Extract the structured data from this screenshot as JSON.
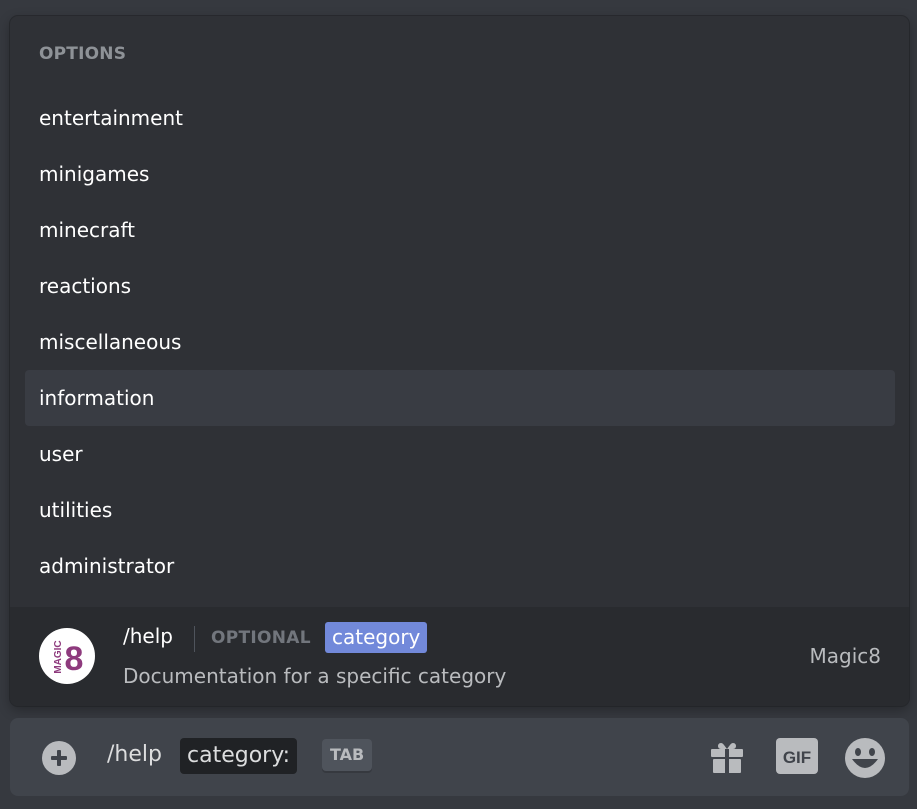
{
  "options": {
    "header": "OPTIONS",
    "items": [
      {
        "label": "entertainment",
        "selected": false
      },
      {
        "label": "minigames",
        "selected": false
      },
      {
        "label": "minecraft",
        "selected": false
      },
      {
        "label": "reactions",
        "selected": false
      },
      {
        "label": "miscellaneous",
        "selected": false
      },
      {
        "label": "information",
        "selected": true
      },
      {
        "label": "user",
        "selected": false
      },
      {
        "label": "utilities",
        "selected": false
      },
      {
        "label": "administrator",
        "selected": false
      }
    ]
  },
  "command": {
    "name": "/help",
    "optional_label": "OPTIONAL",
    "param": "category",
    "description": "Documentation for a specific category",
    "app_name": "Magic8",
    "avatar_text_small": "MAGIC",
    "avatar_text_big": "8",
    "avatar_icon": "magic8-logo-icon"
  },
  "input": {
    "command_text": "/help",
    "param_chip": "category:",
    "tab_hint": "TAB",
    "icons": [
      "plus-circle-icon",
      "gift-icon",
      "gif-icon",
      "emoji-icon"
    ]
  },
  "colors": {
    "accent": "#7289da",
    "background": "#36393f",
    "popup": "#2f3136",
    "command_bar": "#292b2f",
    "input": "#40444b",
    "logo": "#8e3a7d"
  }
}
